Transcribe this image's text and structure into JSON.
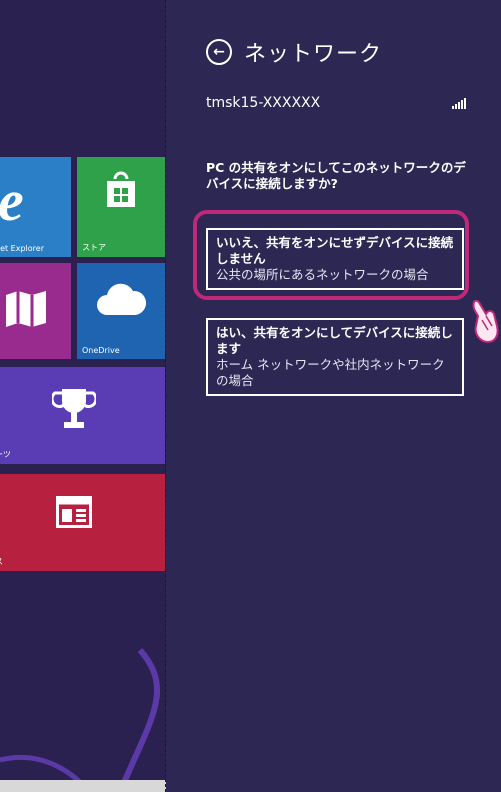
{
  "start_screen": {
    "tiles": {
      "ie_label": "net Explorer",
      "store_label": "ストア",
      "onedrive_label": "OneDrive",
      "sports_label": "ーツ",
      "news_label": "ス"
    }
  },
  "panel": {
    "title": "ネットワーク",
    "network_name": "tmsk15-XXXXXX",
    "question": "PC の共有をオンにしてこのネットワークのデバイスに接続しますか?",
    "options": [
      {
        "title": "いいえ、共有をオンにせずデバイスに接続しません",
        "subtitle": "公共の場所にあるネットワークの場合"
      },
      {
        "title": "はい、共有をオンにしてデバイスに接続します",
        "subtitle": "ホーム ネットワークや社内ネットワークの場合"
      }
    ]
  },
  "colors": {
    "panel_bg": "#2c2753",
    "highlight": "#c0287a",
    "tile_ie": "#2a7fc6",
    "tile_store": "#2fa14a",
    "tile_maps": "#9a2b8e",
    "tile_onedrive": "#1f64b0",
    "tile_sports": "#5a3db5",
    "tile_news": "#b8203f"
  },
  "icons": [
    "back-arrow-icon",
    "signal-strength-icon",
    "ie-icon",
    "store-icon",
    "maps-icon",
    "onedrive-cloud-icon",
    "trophy-icon",
    "news-icon",
    "pointing-hand-icon"
  ]
}
